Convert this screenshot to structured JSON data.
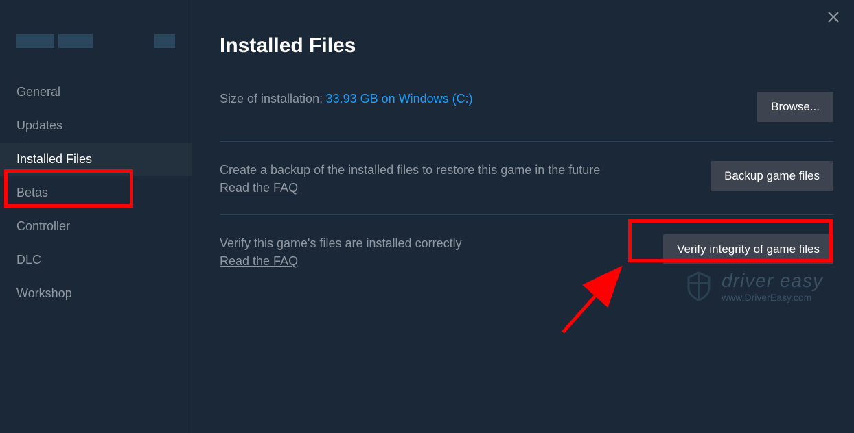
{
  "sidebar": {
    "items": [
      {
        "label": "General",
        "active": false
      },
      {
        "label": "Updates",
        "active": false
      },
      {
        "label": "Installed Files",
        "active": true
      },
      {
        "label": "Betas",
        "active": false
      },
      {
        "label": "Controller",
        "active": false
      },
      {
        "label": "DLC",
        "active": false
      },
      {
        "label": "Workshop",
        "active": false
      }
    ]
  },
  "main": {
    "title": "Installed Files",
    "size_label": "Size of installation:",
    "size_value": "33.93 GB on Windows (C:)",
    "browse_button": "Browse...",
    "backup_description": "Create a backup of the installed files to restore this game in the future",
    "backup_faq": "Read the FAQ",
    "backup_button": "Backup game files",
    "verify_description": "Verify this game's files are installed correctly",
    "verify_faq": "Read the FAQ",
    "verify_button": "Verify integrity of game files"
  },
  "watermark": {
    "brand": "driver easy",
    "url": "www.DriverEasy.com"
  }
}
